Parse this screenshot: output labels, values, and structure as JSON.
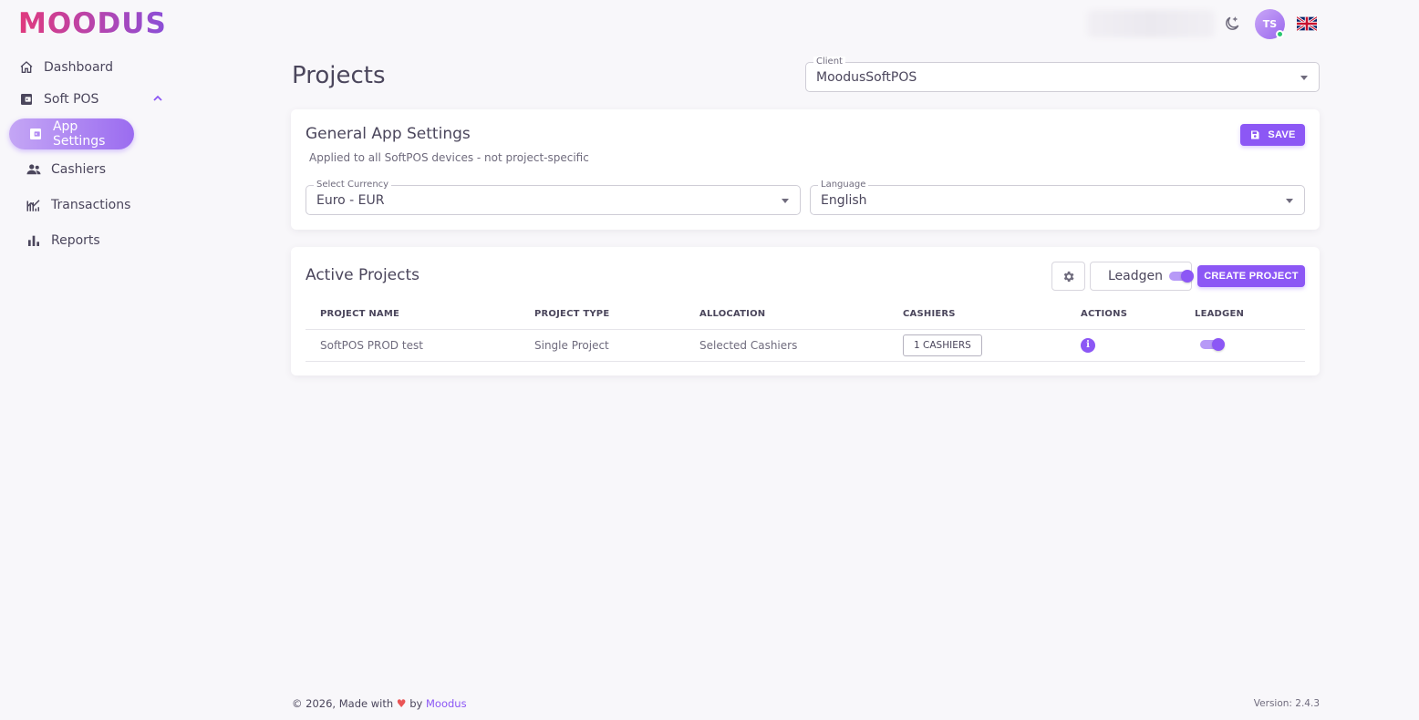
{
  "brand": {
    "logo_text": "MOODUS",
    "gradient": [
      "#e03a7d",
      "#8a4fd8"
    ]
  },
  "sidebar": {
    "items": [
      {
        "label": "Dashboard",
        "icon": "home-icon"
      },
      {
        "label": "Soft POS",
        "icon": "wallet-icon"
      },
      {
        "label": "App Settings",
        "icon": "wallet-icon"
      },
      {
        "label": "Cashiers",
        "icon": "users-icon"
      },
      {
        "label": "Transactions",
        "icon": "chart-line-icon"
      },
      {
        "label": "Reports",
        "icon": "bar-chart-icon"
      }
    ]
  },
  "topbar": {
    "avatar_initials": "TS",
    "language_flag": "uk-flag-icon"
  },
  "page": {
    "title": "Projects"
  },
  "client": {
    "label": "Client",
    "value": "MoodusSoftPOS"
  },
  "general_settings": {
    "title": "General App Settings",
    "subtitle": "Applied to all SoftPOS devices - not project-specific",
    "save_label": "SAVE",
    "currency": {
      "label": "Select Currency",
      "value": "Euro - EUR"
    },
    "language": {
      "label": "Language",
      "value": "English"
    }
  },
  "active_projects": {
    "title": "Active Projects",
    "leadgen_label": "Leadgen",
    "create_label": "CREATE PROJECT",
    "columns": [
      "PROJECT NAME",
      "PROJECT TYPE",
      "ALLOCATION",
      "CASHIERS",
      "ACTIONS",
      "LEADGEN"
    ],
    "rows": [
      {
        "name": "SoftPOS PROD test",
        "type": "Single Project",
        "allocation": "Selected Cashiers",
        "cashiers": "1 CASHIERS"
      }
    ]
  },
  "footer": {
    "left_prefix": "© 2026, Made with",
    "heart": "♥",
    "by": "by",
    "brand_link": "Moodus",
    "version": "Version: 2.4.3"
  },
  "colors": {
    "accent": "#8c57f5",
    "text": "#4b465c",
    "background": "#f8f7fa"
  }
}
